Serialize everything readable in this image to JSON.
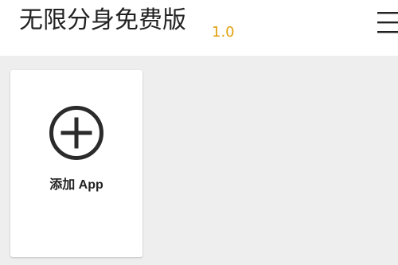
{
  "header": {
    "title": "无限分身免费版",
    "version": "1.0",
    "menu_icon": "hamburger-menu-icon",
    "version_color": "#e0a10e"
  },
  "main": {
    "add_card": {
      "label": "添加 App",
      "icon": "plus-circle-icon"
    }
  }
}
